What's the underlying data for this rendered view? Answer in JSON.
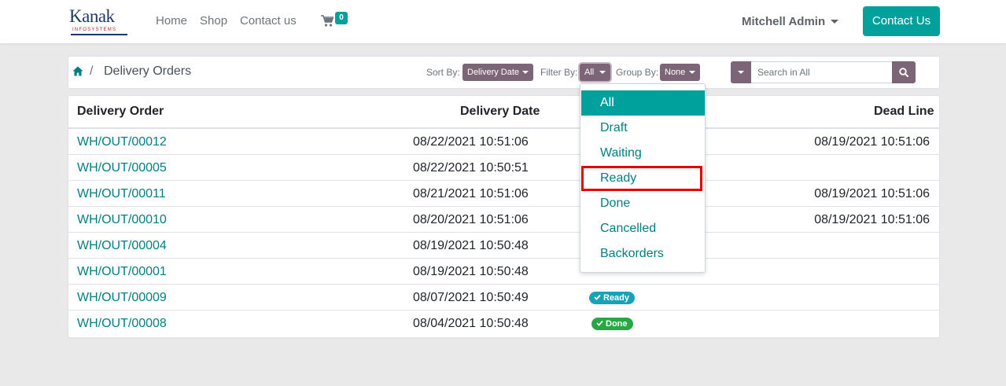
{
  "header": {
    "logo": {
      "main": "Kanak",
      "sub": "INFOSYSTEMS"
    },
    "nav": {
      "home": "Home",
      "shop": "Shop",
      "contact": "Contact us"
    },
    "cart_count": "0",
    "user_name": "Mitchell Admin",
    "contact_button": "Contact Us"
  },
  "toolbar": {
    "breadcrumb_sep": "/",
    "breadcrumb_current": "Delivery Orders",
    "sort_label": "Sort By:",
    "sort_value": "Delivery Date",
    "filter_label": "Filter By:",
    "filter_value": "All",
    "group_label": "Group By:",
    "group_value": "None",
    "search_placeholder": "Search in All"
  },
  "table": {
    "headers": {
      "order": "Delivery Order",
      "date": "Delivery Date",
      "deadline": "Dead Line"
    },
    "rows": [
      {
        "order": "WH/OUT/00012",
        "date": "08/22/2021  10:51:06",
        "deadline": "08/19/2021 10:51:06"
      },
      {
        "order": "WH/OUT/00005",
        "date": "08/22/2021  10:50:51"
      },
      {
        "order": "WH/OUT/00011",
        "date": "08/21/2021  10:51:06",
        "deadline": "08/19/2021 10:51:06"
      },
      {
        "order": "WH/OUT/00010",
        "date": "08/20/2021  10:51:06",
        "deadline": "08/19/2021 10:51:06"
      },
      {
        "order": "WH/OUT/00004",
        "date": "08/19/2021  10:50:48"
      },
      {
        "order": "WH/OUT/00001",
        "date": "08/19/2021  10:50:48"
      },
      {
        "order": "WH/OUT/00009",
        "date": "08/07/2021  10:50:49",
        "status": "Ready"
      },
      {
        "order": "WH/OUT/00008",
        "date": "08/04/2021  10:50:48",
        "status": "Done"
      }
    ]
  },
  "filter_dropdown": {
    "items": [
      "All",
      "Draft",
      "Waiting",
      "Ready",
      "Done",
      "Cancelled",
      "Backorders"
    ],
    "active": "All",
    "highlighted": "Ready"
  },
  "colors": {
    "brand": "#00a09d",
    "toolbar_button": "#7c6576",
    "link": "#017e84",
    "highlight": "#e60000",
    "badge_ready": "#17a2b8",
    "badge_done": "#28a745"
  }
}
